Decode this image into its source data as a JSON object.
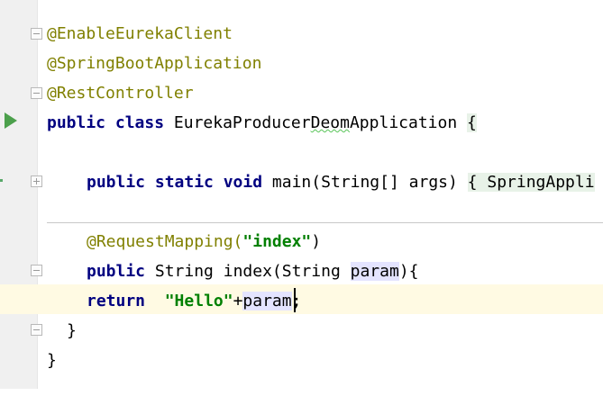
{
  "editor": {
    "lines": {
      "l1": {
        "annotation": "@EnableEurekaClient"
      },
      "l2": {
        "annotation": "@SpringBootApplication"
      },
      "l3": {
        "annotation": "@RestController"
      },
      "l4": {
        "kw": "public class",
        "class_name_pre": "EurekaProducer",
        "class_name_typo": "Deom",
        "class_name_post": "Application",
        "brace": "{"
      },
      "l6": {
        "kw": "public static void",
        "method": "main(String[] args)",
        "brace": "{",
        "collapsed": "SpringAppli"
      },
      "l8": {
        "annotation": "@RequestMapping(",
        "string": "\"index\"",
        "close": ")"
      },
      "l9": {
        "kw": "public",
        "sig_pre": "String index(String",
        "param": "param",
        "sig_post": "){"
      },
      "l10": {
        "kw": "return",
        "string": "\"Hello\"",
        "plus": "+",
        "param": "param",
        "end": ";"
      },
      "l11": {
        "brace": "}"
      },
      "l12": {
        "brace": "}"
      }
    }
  }
}
